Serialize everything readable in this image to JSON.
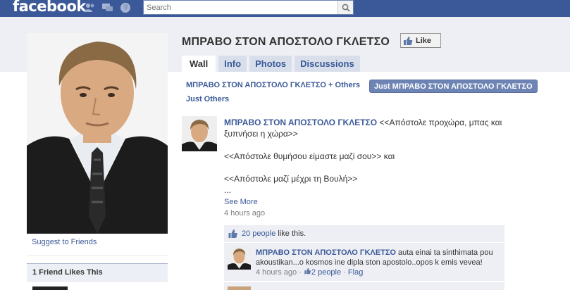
{
  "header": {
    "logo": "facebook",
    "search_placeholder": "Search"
  },
  "page": {
    "title": "ΜΠΡΑΒΟ ΣΤΟΝ ΑΠΟΣΤΟΛΟ ΓΚΛΕΤΣΟ",
    "like_label": "Like"
  },
  "tabs": [
    {
      "label": "Wall"
    },
    {
      "label": "Info"
    },
    {
      "label": "Photos"
    },
    {
      "label": "Discussions"
    }
  ],
  "filters": {
    "others": "ΜΠΡΑΒΟ ΣΤΟΝ ΑΠΟΣΤΟΛΟ ΓΚΛΕΤΣΟ + Others",
    "just_page": "Just ΜΠΡΑΒΟ ΣΤΟΝ ΑΠΟΣΤΟΛΟ ΓΚΛΕΤΣΟ",
    "just_others": "Just Others"
  },
  "sidebar": {
    "suggest": "Suggest to Friends",
    "friends_like": "1 Friend Likes This"
  },
  "post": {
    "author": "ΜΠΡΑΒΟ ΣΤΟΝ ΑΠΟΣΤΟΛΟ ΓΚΛΕΤΣΟ",
    "line1": "<<Απόστολε προχώρα, μπας και ξυπνήσει η χώρα>>",
    "line2": "<<Απόστολε θυμήσου είμαστε μαζί σου>> και",
    "line3": "<<Απόστολε μαζί μέχρι τη Βουλή>>",
    "ellipsis": "...",
    "see_more": "See More",
    "time": "4 hours ago",
    "likes_count": "20 people",
    "likes_suffix": "like this."
  },
  "comment": {
    "author": "ΜΠΡΑΒΟ ΣΤΟΝ ΑΠΟΣΤΟΛΟ ΓΚΛΕΤΣΟ",
    "text": "auta einai ta sinthimata pou akoustikan...o kosmos ine dipla ston apostolo..opos k emis vevea!",
    "time": "4 hours ago",
    "sep": "·",
    "likes": "2 people",
    "flag": "Flag"
  }
}
